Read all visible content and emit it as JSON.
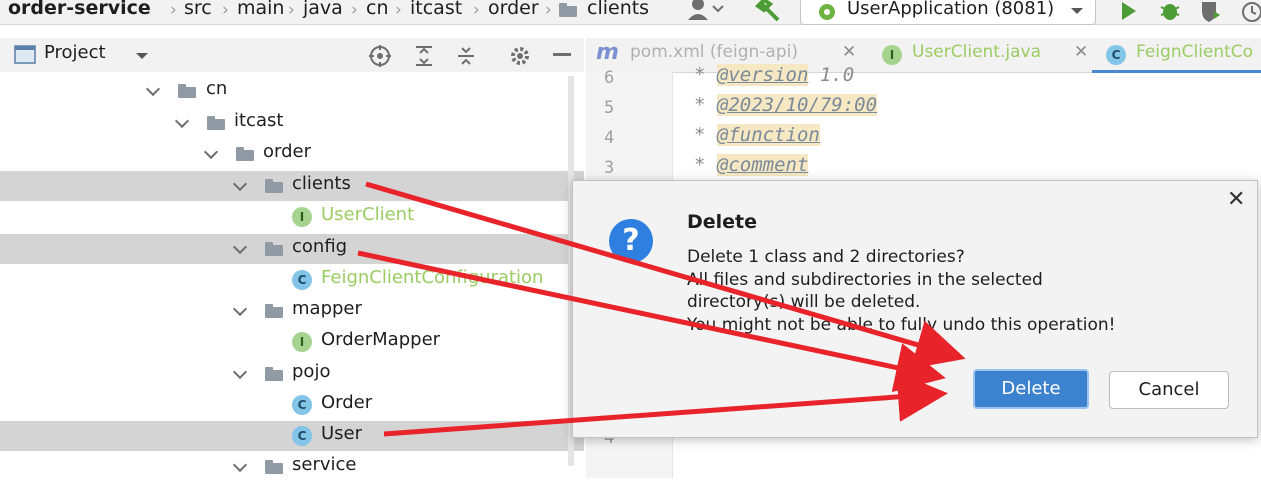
{
  "breadcrumb": {
    "items": [
      "order-service",
      "src",
      "main",
      "java",
      "cn",
      "itcast",
      "order",
      "clients"
    ]
  },
  "toolbar": {
    "run_config": "UserApplication (8081)"
  },
  "project_panel": {
    "title": "Project"
  },
  "tree": {
    "nodes": [
      {
        "label": "cn"
      },
      {
        "label": "itcast"
      },
      {
        "label": "order"
      },
      {
        "label": "clients"
      },
      {
        "label": "UserClient"
      },
      {
        "label": "config"
      },
      {
        "label": "FeignClientConfiguration"
      },
      {
        "label": "mapper"
      },
      {
        "label": "OrderMapper"
      },
      {
        "label": "pojo"
      },
      {
        "label": "Order"
      },
      {
        "label": "User"
      },
      {
        "label": "service"
      }
    ],
    "badges": {
      "interface": "I",
      "class": "C"
    }
  },
  "editor": {
    "tabs": [
      "pom.xml (feign-api)",
      "UserClient.java",
      "FeignClientCo"
    ],
    "lines": [
      {
        "num": "6",
        "prefix": "* ",
        "tag": "@version",
        "rest": " 1.0"
      },
      {
        "num": "5",
        "prefix": "* ",
        "tag": "@2023/10/79:00",
        "rest": ""
      },
      {
        "num": "4",
        "prefix": "* ",
        "tag": "@function",
        "rest": ""
      },
      {
        "num": "3",
        "prefix": "* ",
        "tag": "@comment",
        "rest": ""
      }
    ],
    "bottom_line_num": "4"
  },
  "dialog": {
    "title": "Delete",
    "icon": "?",
    "message_1": "Delete 1 class and 2 directories?",
    "message_2": "All files and subdirectories in the selected",
    "message_3": "directory(s) will be deleted.",
    "message_4": "You might not be able to fully undo this operation!",
    "delete_label": "Delete",
    "cancel_label": "Cancel",
    "close": "✕"
  },
  "colors": {
    "accent": "#3d82cf",
    "selection": "#d4d4d4",
    "arrow": "#e8232a"
  }
}
